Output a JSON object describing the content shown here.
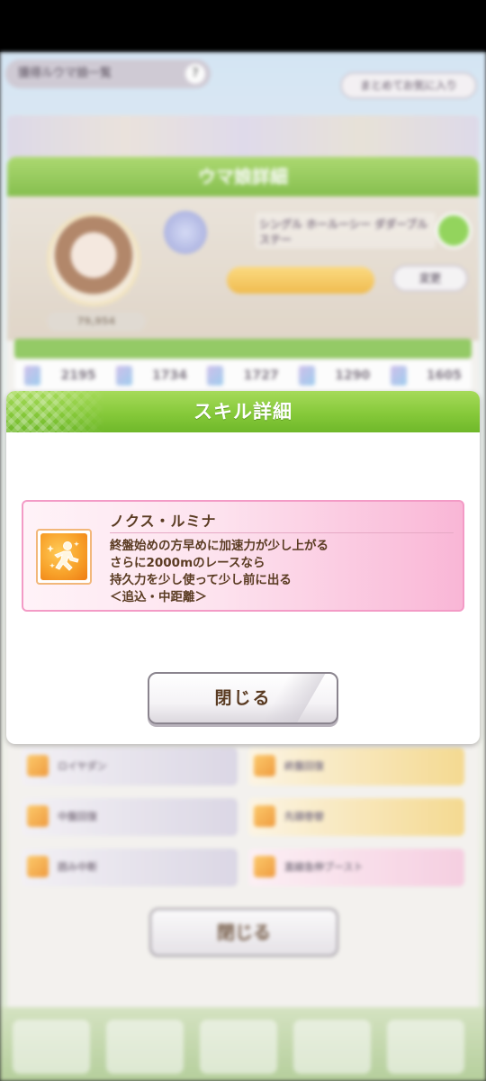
{
  "background": {
    "top_pill_label": "獲得ルウマ娘一覧",
    "recommend_button": "まとめてお気に入り",
    "card_title": "ウマ娘詳細",
    "epithet": "シングル ホールーシー\nダダーブル ステー",
    "change_button": "変更",
    "score": "79,954",
    "stat_values": [
      "2195",
      "1734",
      "1727",
      "1290",
      "1605"
    ],
    "skills": [
      "ロイヤダン",
      "中盤回復",
      "囲み中断",
      "終盤回復",
      "先頭巻替",
      "直線急伸ブースト"
    ],
    "close_label": "閉じる"
  },
  "dialog": {
    "title": "スキル詳細",
    "skill": {
      "name": "ノクス・ルミナ",
      "icon": "running-figure-icon",
      "description_lines": [
        "終盤始めの方早めに加速力が少し上がる",
        "さらに2000mのレースなら",
        "持久力を少し使って少し前に出る",
        "＜追込・中距離＞"
      ]
    },
    "close_label": "閉じる"
  },
  "colors": {
    "header_green": "#86c93a",
    "skill_card_pink": "#f9b6d6",
    "text_brown": "#5a3b22",
    "skill_icon_orange": "#f8a22a"
  }
}
